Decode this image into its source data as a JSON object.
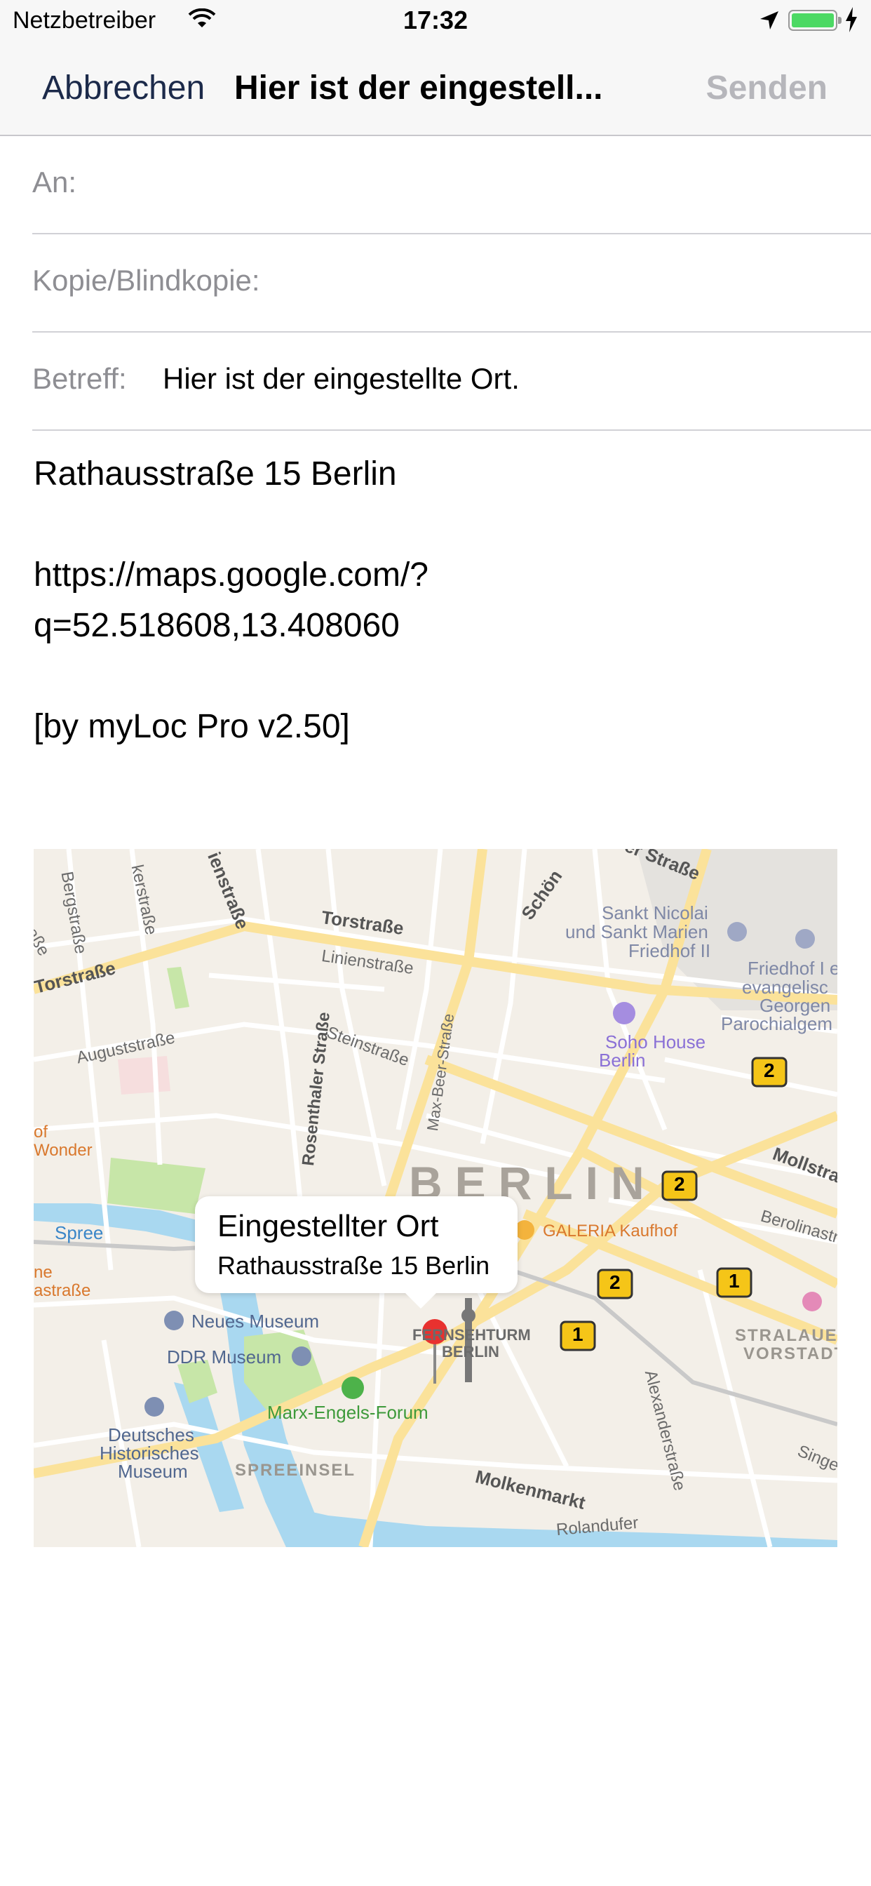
{
  "status_bar": {
    "carrier": "Netzbetreiber",
    "time": "17:32",
    "icons": [
      "wifi-icon",
      "location-arrow-icon",
      "battery-icon",
      "charging-bolt-icon"
    ]
  },
  "navbar": {
    "cancel_label": "Abbrechen",
    "title": "Hier ist der eingestell...",
    "send_label": "Senden"
  },
  "fields": {
    "to_label": "An:",
    "cc_label": "Kopie/Blindkopie:",
    "subject_label": "Betreff:",
    "subject_value": "Hier ist der eingestellte Ort."
  },
  "body": {
    "address": "Rathausstraße 15 Berlin",
    "url_line1": "https://maps.google.com/?",
    "url_line2": "q=52.518608,13.408060",
    "signature": "[by myLoc Pro v2.50]"
  },
  "map": {
    "callout_title": "Eingestellter Ort",
    "callout_subtitle": "Rathausstraße 15 Berlin",
    "city_label": "BERLIN",
    "labels": {
      "bergstrasse": "Bergstraße",
      "ackerstrasse": "kerstraße",
      "linienstrasse_top": "ienstraße",
      "torstrasse": "Torstraße",
      "torstrasse_left": "Torstraße",
      "linienstrasse": "Linienstraße",
      "schoen": "Schön",
      "strasse_top": "er Straße",
      "sankt_nicolai": "Sankt Nicolai",
      "sankt_marien": "und Sankt Marien",
      "friedhof_ii": "Friedhof II",
      "friedhof_1": "Friedhof I e",
      "friedhof_2": "evangelisc",
      "friedhof_3": "Georgen",
      "friedhof_4": "Parochialgem",
      "soho_1": "Soho House",
      "soho_2": "Berlin",
      "strasse_left": "traße",
      "augustsstrasse": "Auguststraße",
      "steinstrasse": "Steinstraße",
      "max_beer": "Max-Beer-Straße",
      "rosenthaler": "Rosenthaler Straße",
      "of_wonder_1": "of",
      "of_wonder_2": "Wonder",
      "mollstrasse": "Mollstra",
      "berolinastrasse": "Berolinastr",
      "galeria": "GALERIA Kaufhof",
      "spree": "Spree",
      "ne": "ne",
      "astrasse": "astraße",
      "neues_museum": "Neues Museum",
      "ddr_museum": "DDR Museum",
      "fernsehturm_1": "FERNSEHTURM",
      "fernsehturm_2": "BERLIN",
      "stralauer_1": "STRALAUE",
      "stralauer_2": "VORSTADT",
      "marx_engels": "Marx-Engels-Forum",
      "alexanderstrasse": "Alexanderstraße",
      "dhm_1": "Deutsches",
      "dhm_2": "Historisches",
      "dhm_3": "Museum",
      "spreeinsel": "SPREEINSEL",
      "molkenmarkt": "Molkenmarkt",
      "rolandufer": "Rolandufer",
      "singer": "Singe"
    },
    "badges": [
      "2",
      "2",
      "2",
      "1",
      "1"
    ],
    "colors": {
      "land": "#f3efe8",
      "road": "#ffffff",
      "major_road": "#fbe29a",
      "water": "#a9d8f0",
      "park": "#c7e6a8",
      "pin": "#e8312f",
      "badge": "#f5c518"
    }
  },
  "colors": {
    "bar_bg": "#f7f7f7",
    "cancel_text": "#1c2a4a",
    "disabled_text": "#b6b6bb",
    "label_text": "#8e8e93",
    "separator": "#d1d1d6"
  }
}
